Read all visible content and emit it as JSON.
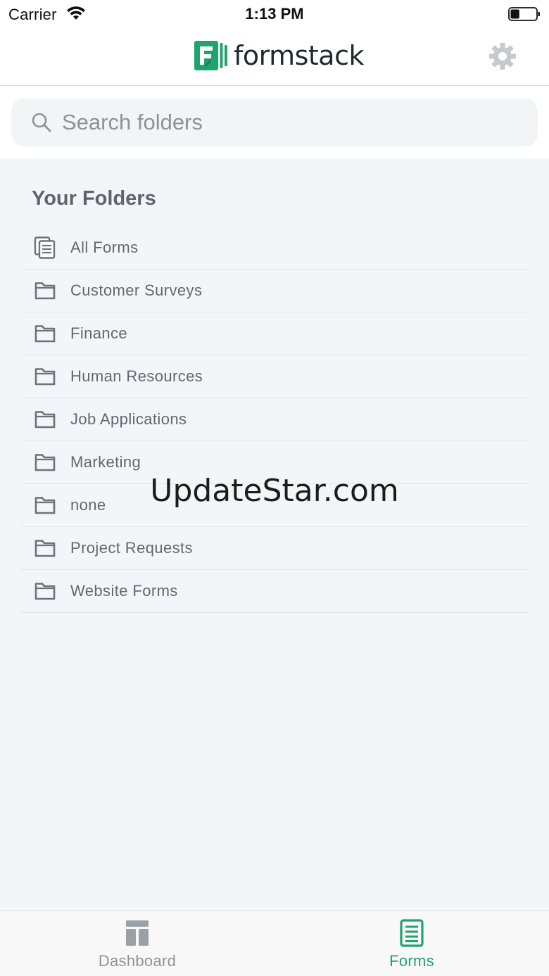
{
  "status_bar": {
    "carrier": "Carrier",
    "time": "1:13 PM",
    "icons": [
      "wifi-icon",
      "battery-icon"
    ],
    "battery_level": 0.35
  },
  "header": {
    "logo_text": "formstack",
    "logo_color": "#21a36e",
    "settings_icon": "gear-icon"
  },
  "search": {
    "placeholder": "Search folders",
    "value": "",
    "icon": "search-icon"
  },
  "folders": {
    "title": "Your Folders",
    "items": [
      {
        "label": "All Forms",
        "icon": "forms-stack-icon"
      },
      {
        "label": "Customer Surveys",
        "icon": "folder-icon"
      },
      {
        "label": "Finance",
        "icon": "folder-icon"
      },
      {
        "label": "Human Resources",
        "icon": "folder-icon"
      },
      {
        "label": "Job Applications",
        "icon": "folder-icon"
      },
      {
        "label": "Marketing",
        "icon": "folder-icon"
      },
      {
        "label": "none",
        "icon": "folder-icon"
      },
      {
        "label": "Project Requests",
        "icon": "folder-icon"
      },
      {
        "label": "Website Forms",
        "icon": "folder-icon"
      }
    ]
  },
  "watermark": "UpdateStar.com",
  "tab_bar": {
    "tabs": [
      {
        "label": "Dashboard",
        "icon": "dashboard-icon",
        "active": false
      },
      {
        "label": "Forms",
        "icon": "forms-icon",
        "active": true
      }
    ],
    "active_color": "#21a36e",
    "inactive_color": "#8e9399"
  }
}
